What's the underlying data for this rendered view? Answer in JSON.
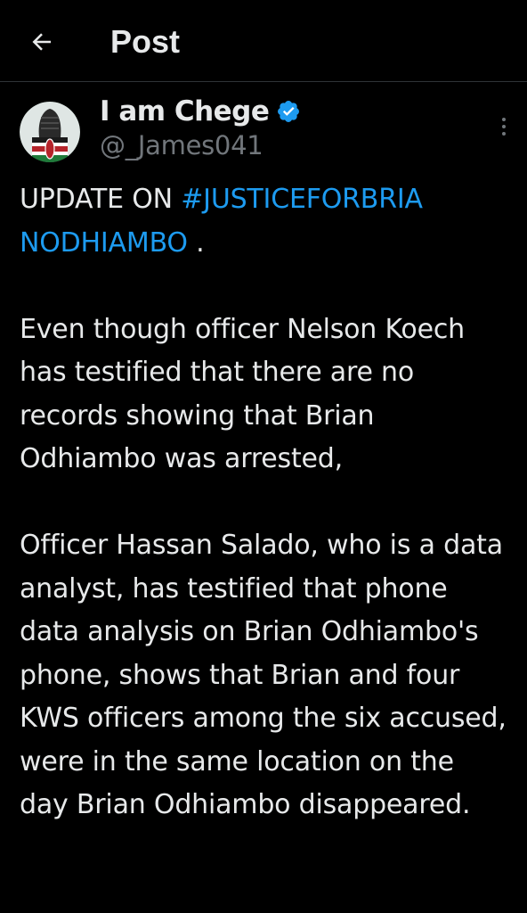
{
  "header": {
    "title": "Post",
    "back_icon": "arrow-left-icon"
  },
  "author": {
    "display_name": "I am Chege",
    "handle": "@_James041",
    "verified_icon": "verified-badge-icon",
    "avatar_icon": "avatar-raised-fist-kenya-flag"
  },
  "post": {
    "line1": "UPDATE ON ",
    "hashtag1": "#JUSTICEFORBRIA",
    "hashtag2": "NODHIAMBO",
    "line1_end": " .",
    "paragraph2": "Even though officer Nelson Koech has testified that there are no records showing that Brian Odhiambo was arrested,",
    "paragraph3": "Officer Hassan Salado, who is a data analyst, has testified that phone data analysis on Brian Odhiambo's phone, shows that Brian and four KWS officers among the six accused, were in the same location on the day Brian Odhiambo disappeared."
  },
  "colors": {
    "background": "#000000",
    "text": "#e7e9ea",
    "muted": "#71767b",
    "link": "#1d9bf0",
    "divider": "#2f3336"
  }
}
